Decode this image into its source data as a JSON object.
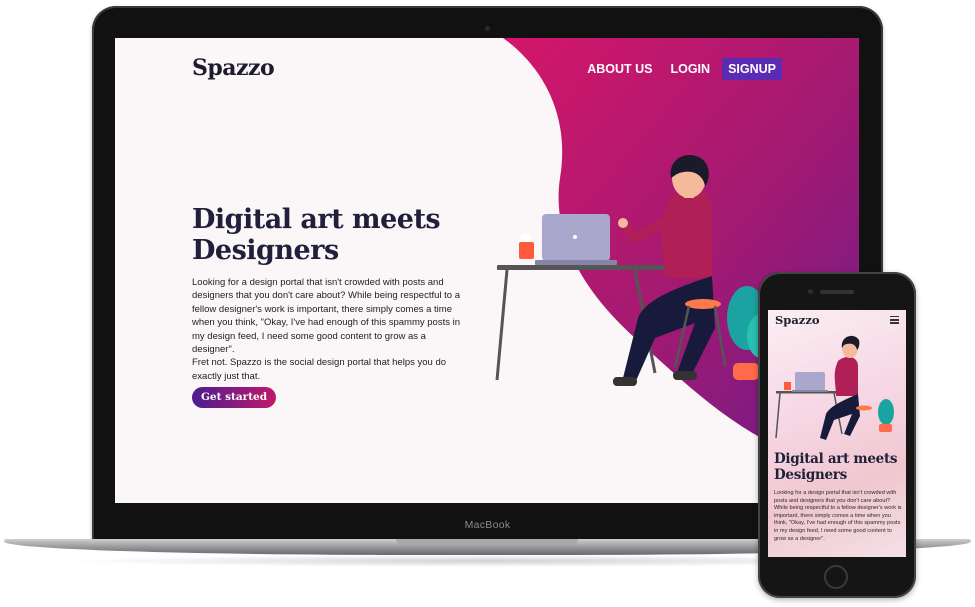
{
  "laptop": {
    "model_label": "MacBook",
    "site": {
      "brand": "Spazzo",
      "nav": [
        {
          "label": "ABOUT US"
        },
        {
          "label": "LOGIN"
        },
        {
          "label": "SIGNUP"
        }
      ],
      "hero": {
        "title": "Digital art meets Designers",
        "paragraph1": "Looking for a design portal that isn't crowded with posts and designers that you don't care about? While being respectful to a fellow designer's work is important, there simply comes a time when you think, \"Okay, I've had enough of this spammy posts in my design feed, I need some good content to grow as a designer\".",
        "paragraph2": "Fret not. Spazzo is the social design portal that helps you do exactly just that.",
        "cta_label": "Get started"
      }
    }
  },
  "phone": {
    "site": {
      "brand": "Spazzo",
      "menu_icon": "hamburger-icon",
      "hero": {
        "title": "Digital art meets Designers",
        "paragraph": "Looking for a design portal that isn't crowded with posts and designers that you don't care about? While being respectful to a fellow designer's work is important, there simply comes a time when you think, \"Okay, I've had enough of this spammy posts in my design feed, I need some good content to grow as a designer\"."
      }
    }
  },
  "colors": {
    "accent_magenta": "#c0196a",
    "accent_purple": "#5b2bb3",
    "heading": "#20203a"
  }
}
